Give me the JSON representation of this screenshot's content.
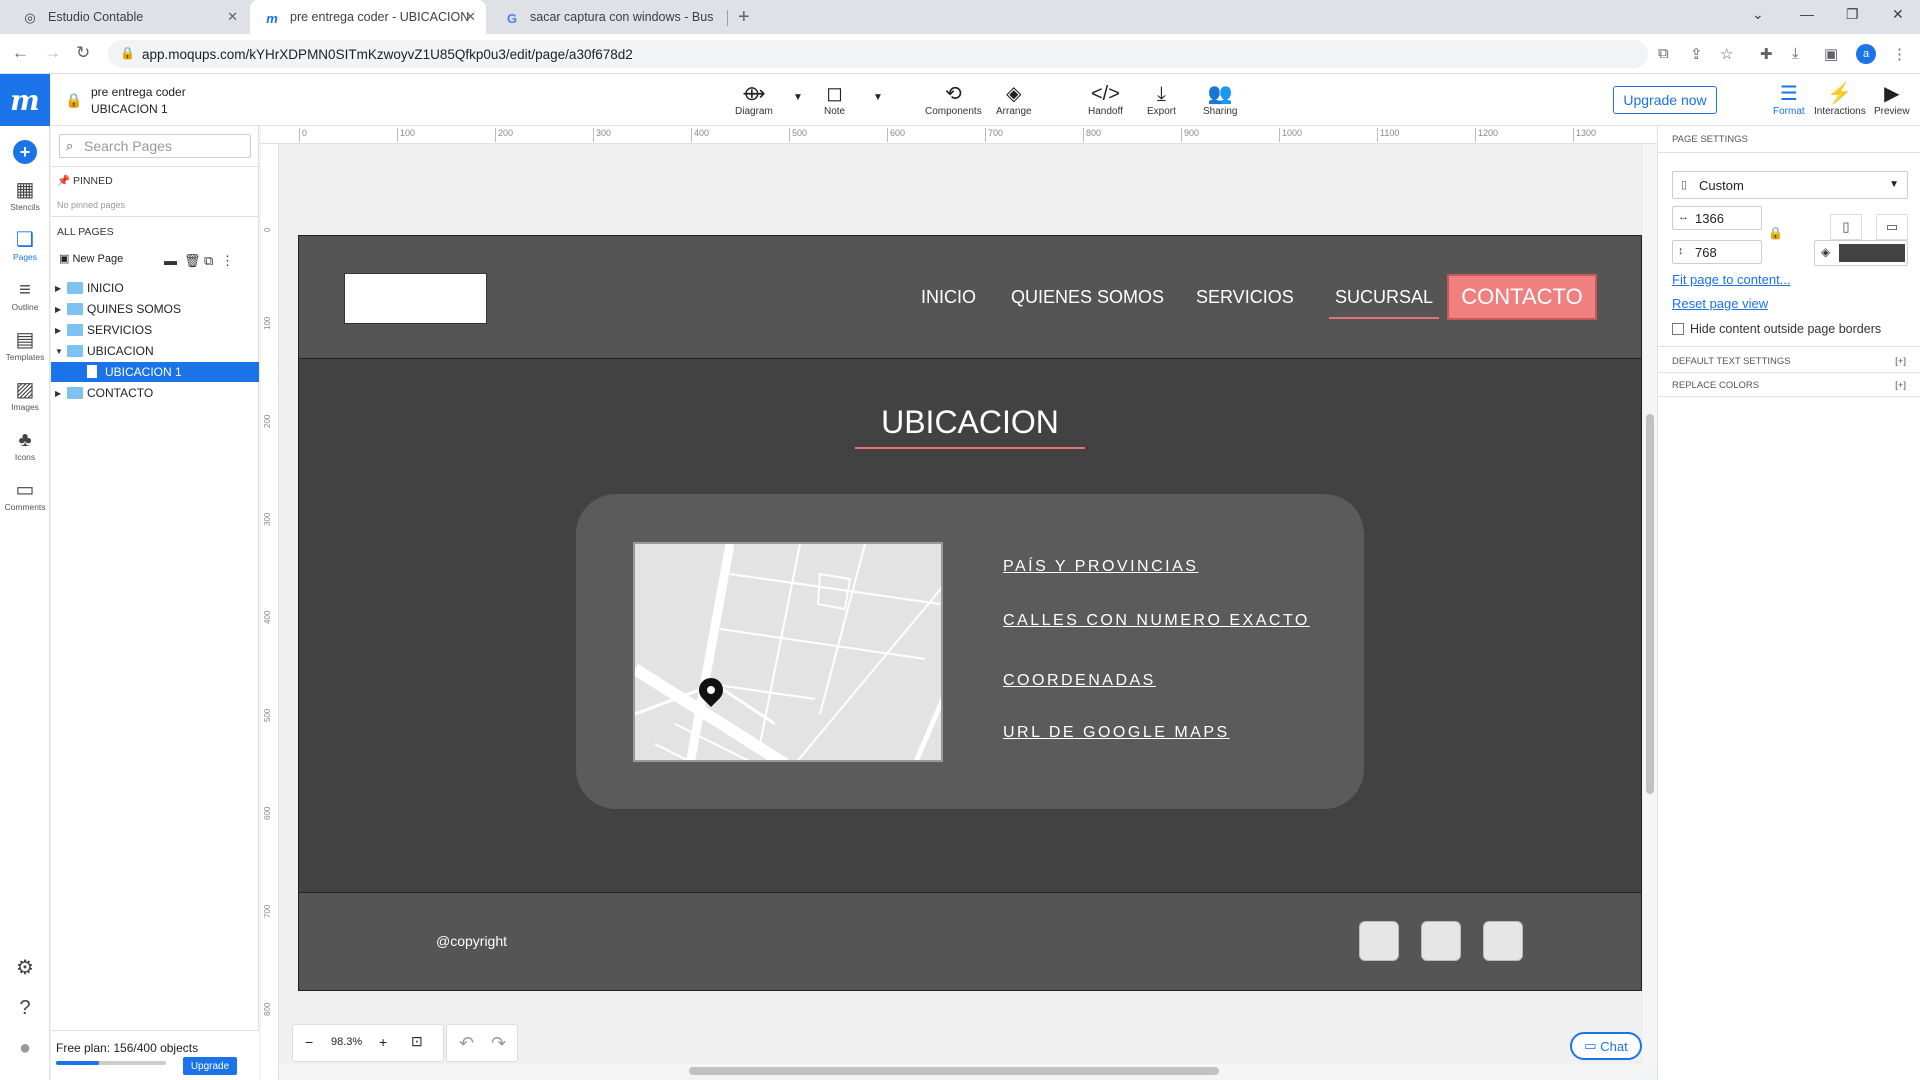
{
  "browser": {
    "tabs": [
      {
        "title": "Estudio Contable",
        "icon": "globe-icon"
      },
      {
        "title": "pre entrega coder - UBICACION",
        "icon": "moqups-icon"
      },
      {
        "title": "sacar captura con windows - Bus",
        "icon": "google-icon"
      }
    ],
    "url": "app.moqups.com/kYHrXDPMN0SITmKzwoyvZ1U85Qfkp0u3/edit/page/a30f678d2",
    "profile_initial": "a"
  },
  "app": {
    "logo": "m",
    "doc_title": "pre entrega coder",
    "page_name": "UBICACION 1",
    "rail": [
      {
        "label": "Stencils",
        "icon": "stencils-icon"
      },
      {
        "label": "Pages",
        "icon": "pages-icon"
      },
      {
        "label": "Outline",
        "icon": "outline-icon"
      },
      {
        "label": "Templates",
        "icon": "templates-icon"
      },
      {
        "label": "Images",
        "icon": "images-icon"
      },
      {
        "label": "Icons",
        "icon": "icons-icon"
      },
      {
        "label": "Comments",
        "icon": "comments-icon"
      }
    ],
    "toolbar": {
      "diagram": "Diagram",
      "note": "Note",
      "components": "Components",
      "arrange": "Arrange",
      "handoff": "Handoff",
      "export": "Export",
      "sharing": "Sharing",
      "upgrade": "Upgrade now",
      "format": "Format",
      "interactions": "Interactions",
      "preview": "Preview"
    },
    "pages_panel": {
      "search_placeholder": "Search Pages",
      "pinned": "PINNED",
      "no_pinned": "No pinned pages",
      "all_pages": "ALL PAGES",
      "new_page": "New Page",
      "tree": [
        "INICIO",
        "QUINES SOMOS",
        "SERVICIOS",
        "UBICACION",
        "UBICACION 1",
        "CONTACTO"
      ],
      "free_plan": "Free plan: 156/400 objects",
      "free_plan_usage": 0.39,
      "upgrade": "Upgrade"
    },
    "zoom": "98.3%",
    "chat": "Chat",
    "ruler_top": [
      "0",
      "100",
      "200",
      "300",
      "400",
      "500",
      "600",
      "700",
      "800",
      "900",
      "1000",
      "1100",
      "1200",
      "1300"
    ],
    "ruler_left": [
      "0",
      "100",
      "200",
      "300",
      "400",
      "500",
      "600",
      "700",
      "800"
    ]
  },
  "mockup": {
    "nav": [
      "INICIO",
      "QUIENES SOMOS",
      "SERVICIOS",
      "SUCURSAL"
    ],
    "contact": "CONTACTO",
    "title": "UBICACION",
    "links": [
      "PAÍS Y PROVINCIAS",
      "CALLES CON NUMERO EXACTO",
      "COORDENADAS",
      "URL DE GOOGLE MAPS"
    ],
    "copyright": "@copyright",
    "colors": {
      "header": "#555555",
      "body": "#424242",
      "accent": "#f08080"
    }
  },
  "right_panel": {
    "title": "PAGE SETTINGS",
    "size_preset": "Custom",
    "width": "1366",
    "height": "768",
    "bg_color": "#424242",
    "fit": "Fit page to content...",
    "reset": "Reset page view",
    "hide_outside": "Hide content outside page borders",
    "default_text": "DEFAULT TEXT SETTINGS",
    "replace_colors": "REPLACE COLORS",
    "expand": "[+]"
  }
}
